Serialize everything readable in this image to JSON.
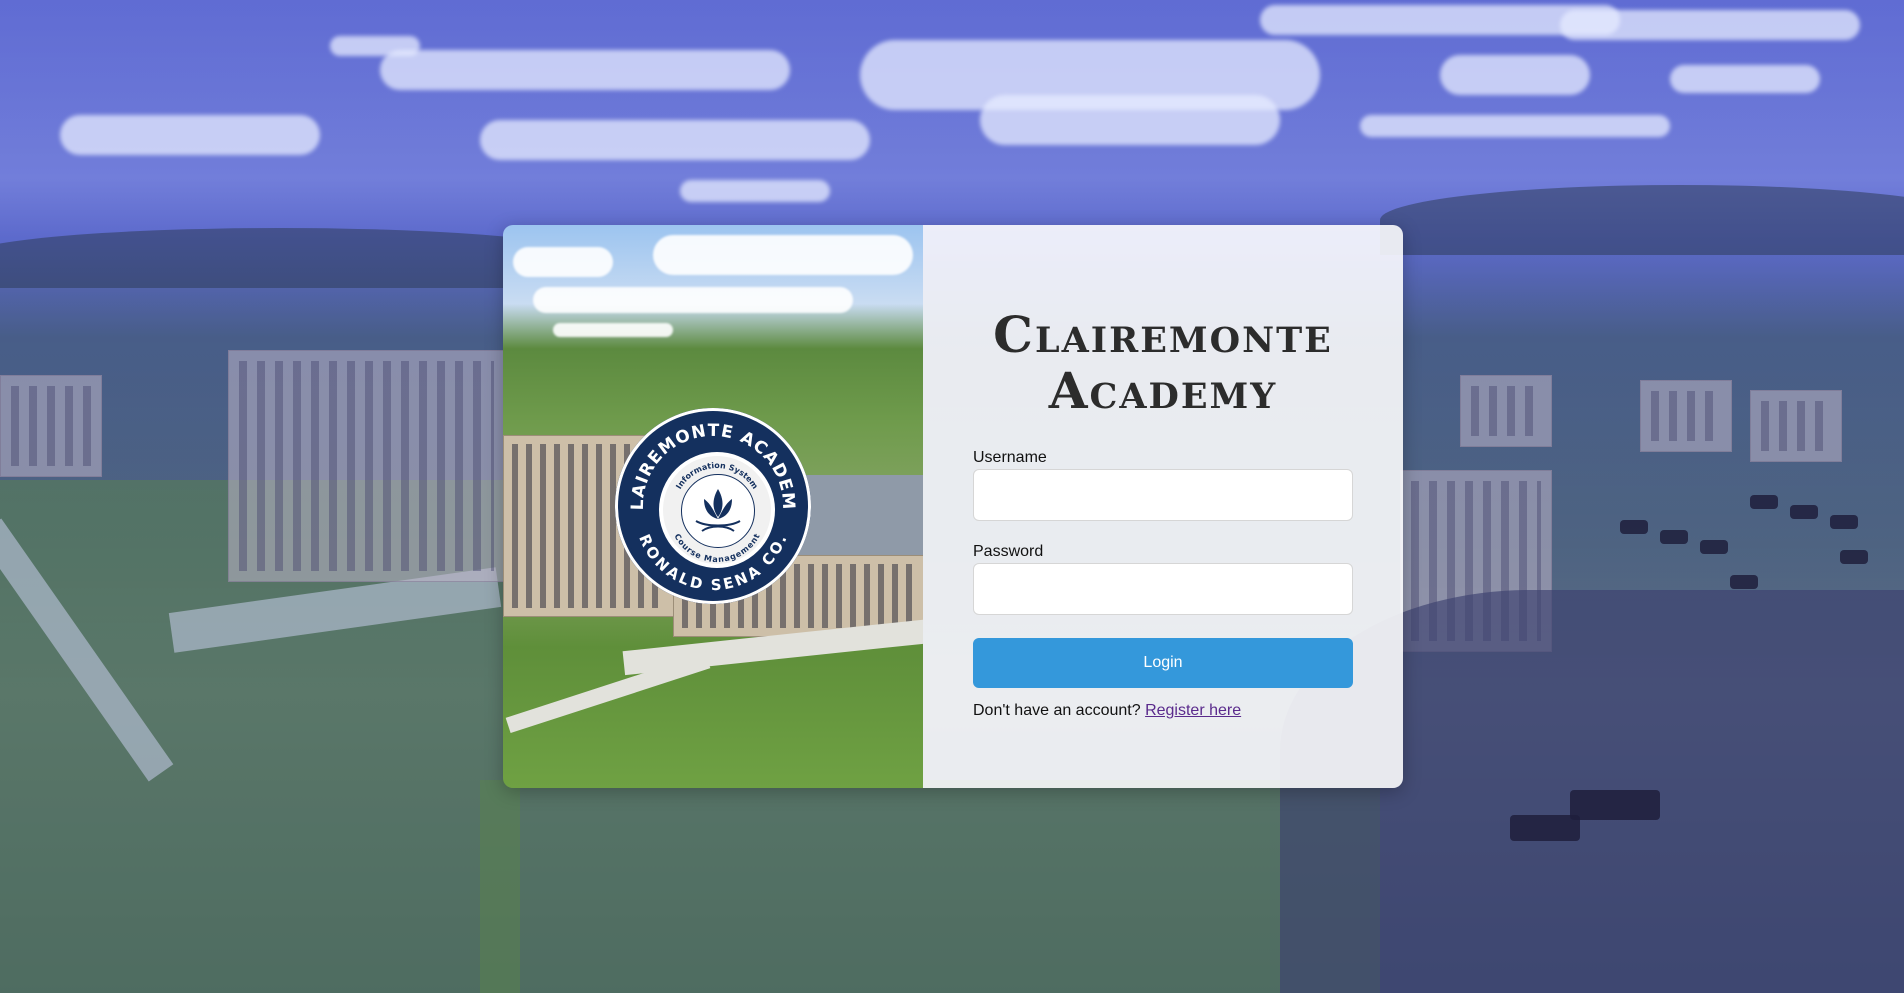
{
  "brand": {
    "line1": "Clairemonte",
    "line2": "Academy"
  },
  "seal": {
    "outer_top": "CLAIREMONTE ACADEMY",
    "outer_bottom": "RONALD SENA CO.",
    "inner_top": "Information System",
    "inner_bottom": "Course Management"
  },
  "form": {
    "username_label": "Username",
    "username_value": "",
    "password_label": "Password",
    "password_value": "",
    "login_label": "Login",
    "register_prompt": "Don't have an account?",
    "register_link": "Register here"
  },
  "colors": {
    "primary_button": "#3498db",
    "seal_navy": "#14305e",
    "link": "#5a2a8c"
  }
}
